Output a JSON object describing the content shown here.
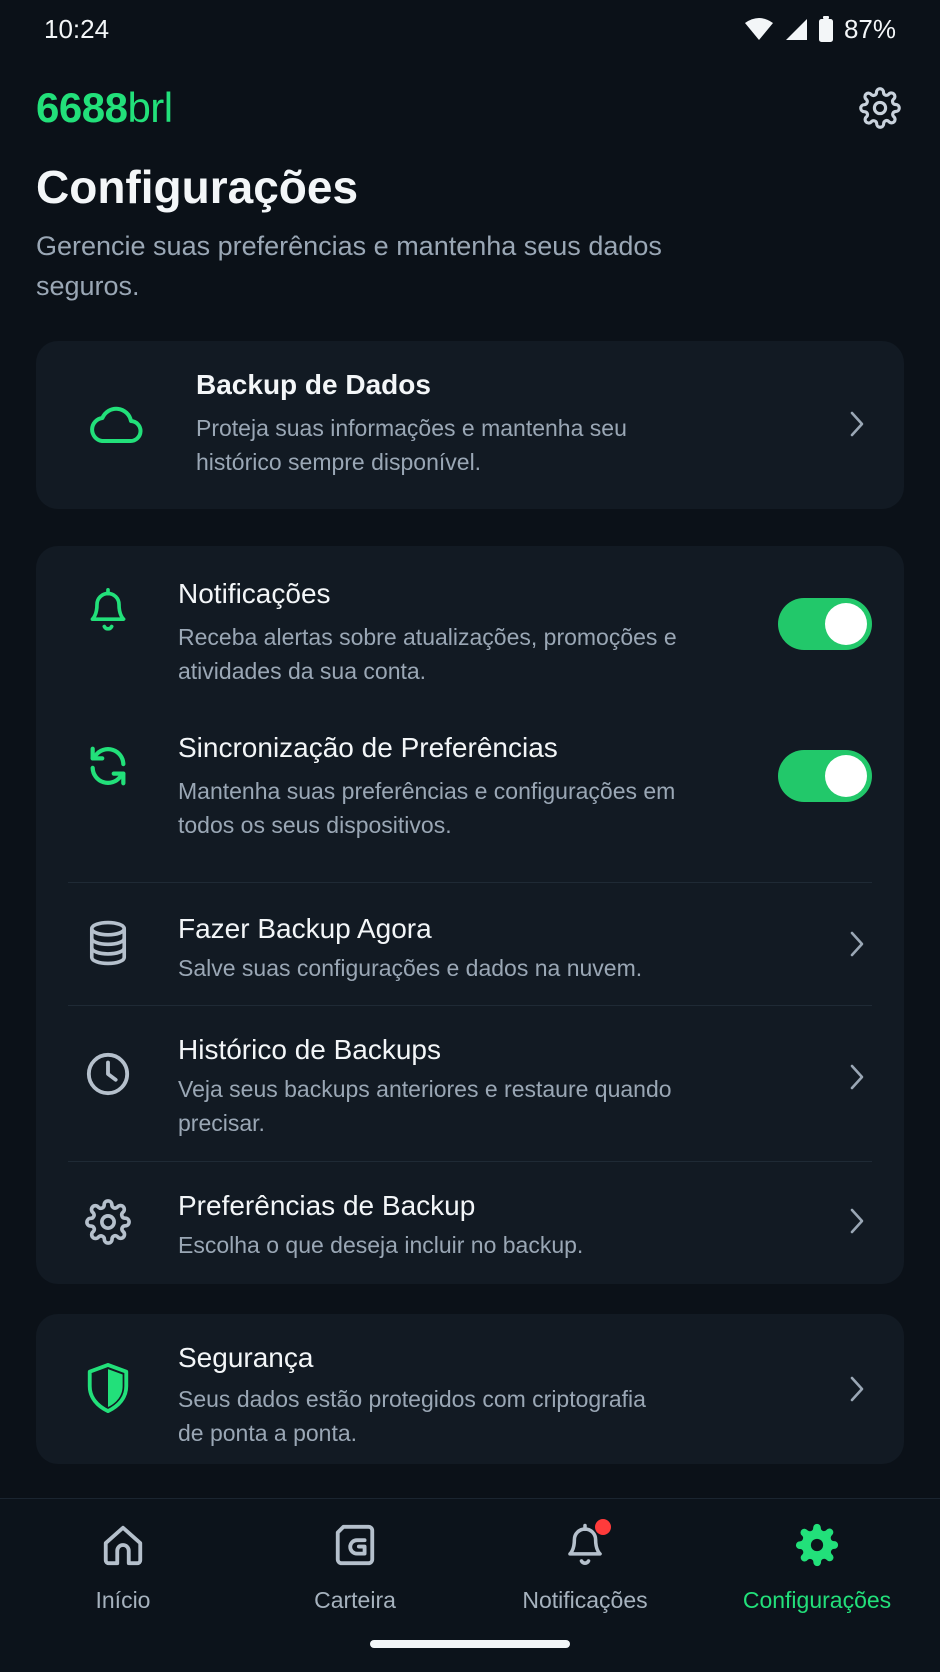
{
  "status_bar": {
    "time": "10:24",
    "battery": "87%"
  },
  "header": {
    "logo_main": "6688",
    "logo_suffix": "brl"
  },
  "page": {
    "title": "Configurações",
    "subtitle": "Gerencie suas preferências e mantenha seus dados seguros."
  },
  "backup_card": {
    "title": "Backup de Dados",
    "desc": "Proteja suas informações e mantenha seu histórico sempre disponível."
  },
  "settings": {
    "notifications": {
      "title": "Notificações",
      "desc": "Receba alertas sobre atualizações, promoções e atividades da sua conta.",
      "enabled": true
    },
    "sync": {
      "title": "Sincronização de Preferências",
      "desc": "Mantenha suas preferências e configurações em todos os seus dispositivos.",
      "enabled": true
    },
    "backup_now": {
      "title": "Fazer Backup Agora",
      "desc": "Salve suas configurações e dados na nuvem."
    },
    "history": {
      "title": "Histórico de Backups",
      "desc": "Veja seus backups anteriores e restaure quando precisar."
    },
    "prefs": {
      "title": "Preferências de Backup",
      "desc": "Escolha o que deseja incluir no backup."
    }
  },
  "security_card": {
    "title": "Segurança",
    "desc": "Seus dados estão protegidos com criptografia de ponta a ponta."
  },
  "nav": {
    "items": [
      {
        "label": "Início"
      },
      {
        "label": "Carteira"
      },
      {
        "label": "Notificações"
      },
      {
        "label": "Configurações"
      }
    ],
    "active": "Configurações"
  },
  "colors": {
    "accent": "#22e07a",
    "background": "#0b1118",
    "card": "#121a23",
    "badge": "#ff3b3b"
  }
}
